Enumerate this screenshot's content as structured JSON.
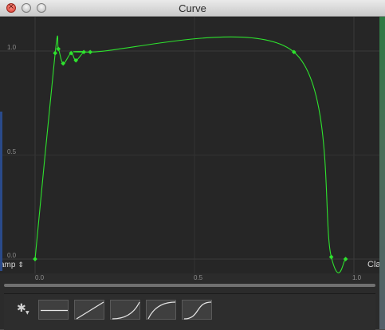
{
  "window": {
    "title": "Curve"
  },
  "curve_editor": {
    "y_labels": [
      "1.0",
      "0.5",
      "0.0"
    ],
    "x_labels": [
      "0.0",
      "0.5",
      "1.0"
    ],
    "pre_wrap_mode": "amp",
    "pre_wrap_arrow": "⇕",
    "post_wrap_mode": "Clan",
    "colors": {
      "curve": "#2ee22e",
      "background": "#262626",
      "grid": "#3a3a3a"
    },
    "keyframes": [
      {
        "t": 0.0,
        "v": 0.0
      },
      {
        "t": 0.063,
        "v": 0.99
      },
      {
        "t": 0.073,
        "v": 1.01
      },
      {
        "t": 0.088,
        "v": 0.94
      },
      {
        "t": 0.113,
        "v": 0.99
      },
      {
        "t": 0.128,
        "v": 0.955
      },
      {
        "t": 0.153,
        "v": 0.995
      },
      {
        "t": 0.173,
        "v": 0.995
      },
      {
        "t": 0.812,
        "v": 0.995
      },
      {
        "t": 0.929,
        "v": 0.01
      },
      {
        "t": 0.974,
        "v": 0.0
      }
    ]
  },
  "presets": {
    "settings_icon": "gear-icon",
    "items": [
      "flat",
      "linear",
      "ease-in",
      "ease-out",
      "ease-in-out"
    ]
  }
}
